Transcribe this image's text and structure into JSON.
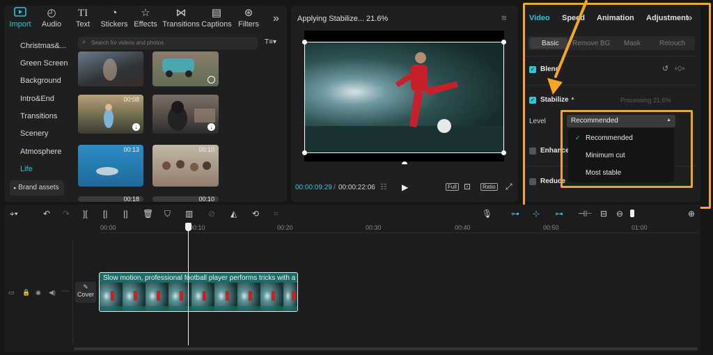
{
  "toolbar": {
    "items": [
      {
        "label": "Import",
        "icon": "import-icon"
      },
      {
        "label": "Audio",
        "icon": "audio-icon"
      },
      {
        "label": "Text",
        "icon": "text-icon"
      },
      {
        "label": "Stickers",
        "icon": "stickers-icon"
      },
      {
        "label": "Effects",
        "icon": "effects-icon"
      },
      {
        "label": "Transitions",
        "icon": "transitions-icon"
      },
      {
        "label": "Captions",
        "icon": "captions-icon"
      },
      {
        "label": "Filters",
        "icon": "filters-icon"
      }
    ],
    "more": "»"
  },
  "sidebar": {
    "items": [
      "Christmas&...",
      "Green Screen",
      "Background",
      "Intro&End",
      "Transitions",
      "Scenery",
      "Atmosphere",
      "Life"
    ],
    "active": "Life",
    "brand_assets": "Brand assets"
  },
  "search": {
    "placeholder": "Search for videos and photos"
  },
  "media": {
    "durations": [
      "00:08",
      "00:13",
      "00:10",
      "00:18",
      "00:10"
    ]
  },
  "player": {
    "title": "Applying Stabilize... 21.6%",
    "current_time": "00:00:09:29",
    "separator": "/",
    "total_time": "00:00:22:06",
    "buttons": {
      "full": "Full",
      "ratio": "Ratio"
    }
  },
  "inspector": {
    "tabs": [
      "Video",
      "Speed",
      "Animation",
      "Adjustment"
    ],
    "active_tab": "Video",
    "subtabs": [
      "Basic",
      "Remove BG",
      "Mask",
      "Retouch"
    ],
    "active_subtab": "Basic",
    "blend": "Blend",
    "stabilize": "Stabilize",
    "processing": "Processing 21.6%",
    "level_label": "Level",
    "level_value": "Recommended",
    "enhance": "Enhance",
    "reduce": "Reduce",
    "dropdown": {
      "options": [
        "Recommended",
        "Minimum cut",
        "Most stable"
      ],
      "selected": "Recommended"
    }
  },
  "timeline": {
    "ruler": [
      "00:00",
      "00:10",
      "00:20",
      "00:30",
      "00:40",
      "00:50",
      "01:00"
    ],
    "clip_title": "Slow motion, professional football player performs tricks with a soc",
    "cover_label": "Cover"
  },
  "colors": {
    "accent": "#2bc8d8",
    "highlight": "#f5a623"
  }
}
